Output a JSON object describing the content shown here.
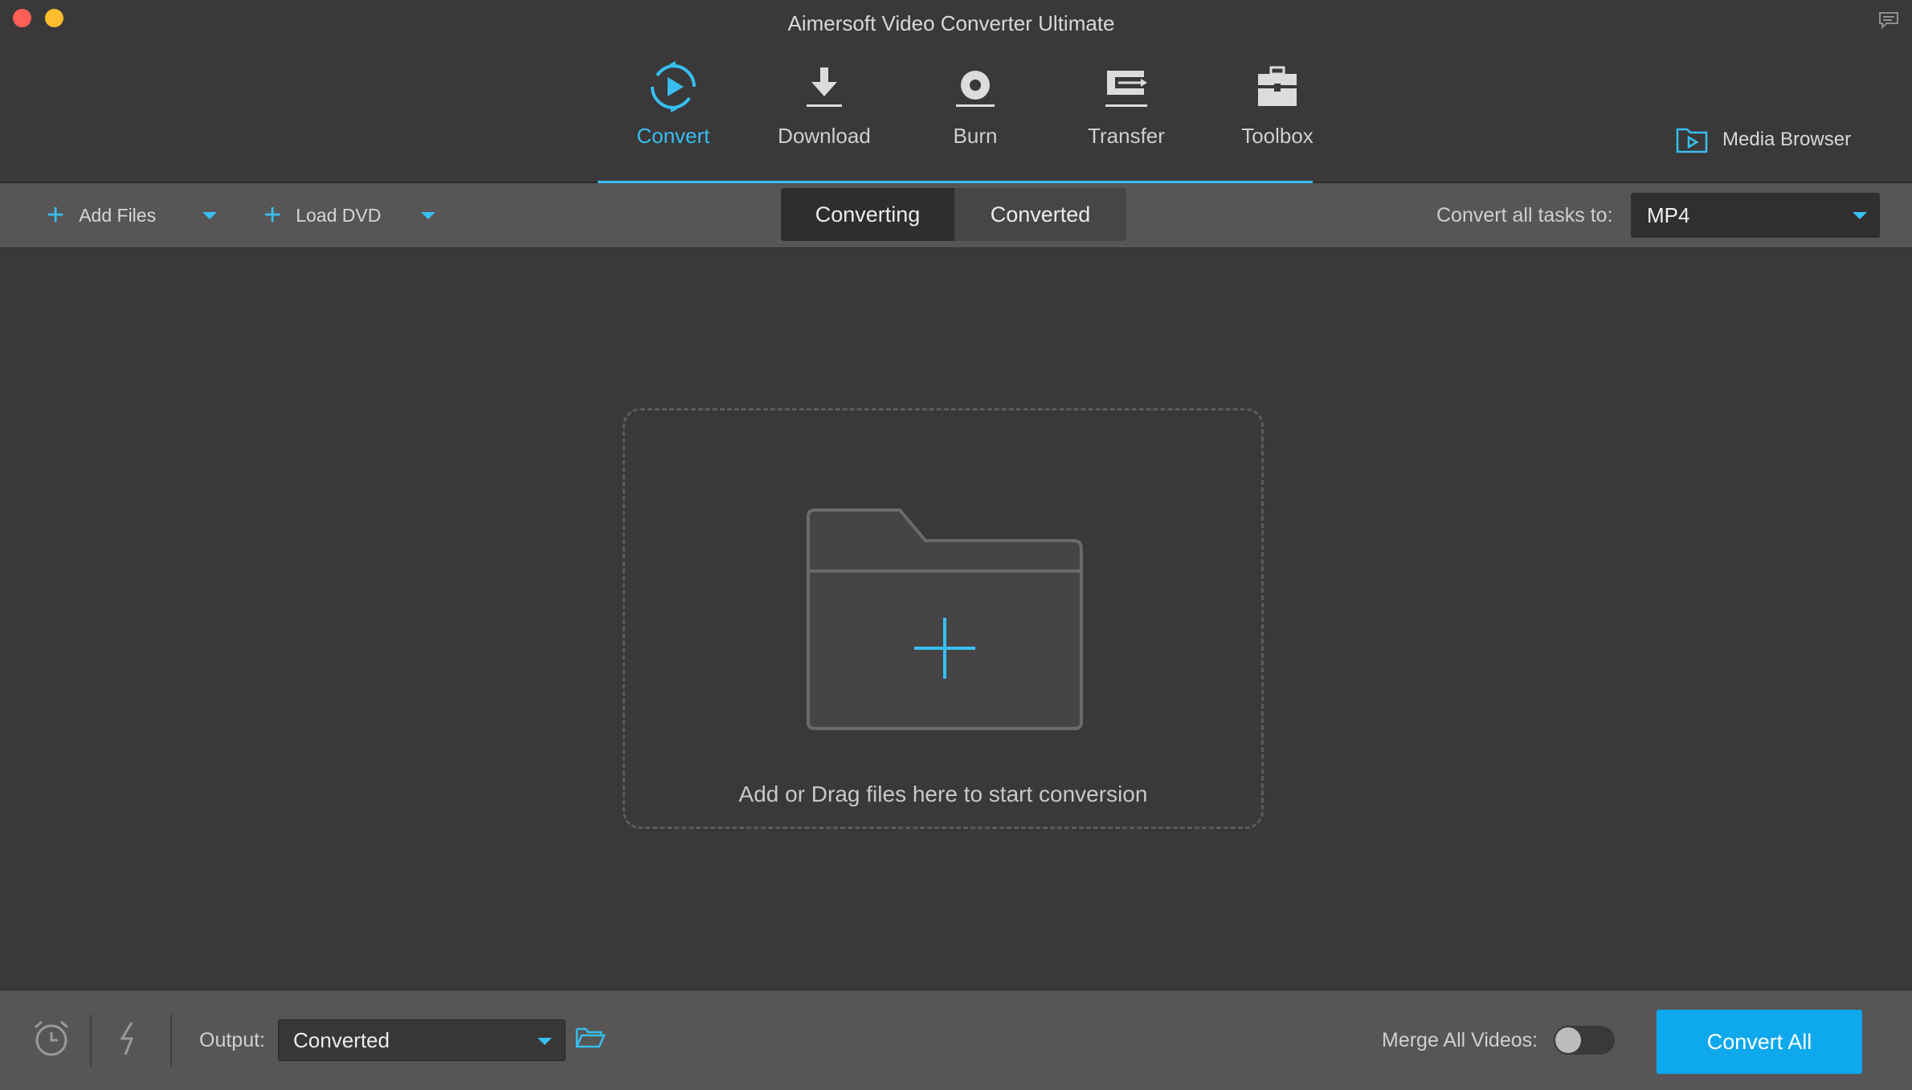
{
  "window": {
    "title": "Aimersoft Video Converter Ultimate"
  },
  "nav": [
    {
      "label": "Convert",
      "icon": "convert-icon",
      "active": true
    },
    {
      "label": "Download",
      "icon": "download-icon",
      "active": false
    },
    {
      "label": "Burn",
      "icon": "burn-icon",
      "active": false
    },
    {
      "label": "Transfer",
      "icon": "transfer-icon",
      "active": false
    },
    {
      "label": "Toolbox",
      "icon": "toolbox-icon",
      "active": false
    }
  ],
  "media_browser": {
    "label": "Media Browser",
    "icon": "media-browser-icon"
  },
  "toolbar": {
    "add_files": "Add Files",
    "load_dvd": "Load DVD",
    "tabs": [
      {
        "label": "Converting",
        "active": true
      },
      {
        "label": "Converted",
        "active": false
      }
    ],
    "convert_all_label": "Convert all tasks to:",
    "format": "MP4"
  },
  "dropzone": {
    "text": "Add or Drag files here to start conversion"
  },
  "footer": {
    "output_label": "Output:",
    "output_value": "Converted",
    "merge_label": "Merge All Videos:",
    "merge_enabled": false,
    "convert_all_button": "Convert All"
  },
  "colors": {
    "accent": "#37bff0",
    "button": "#0ea8ec",
    "background": "#3a3839",
    "toolbar": "#575556"
  }
}
